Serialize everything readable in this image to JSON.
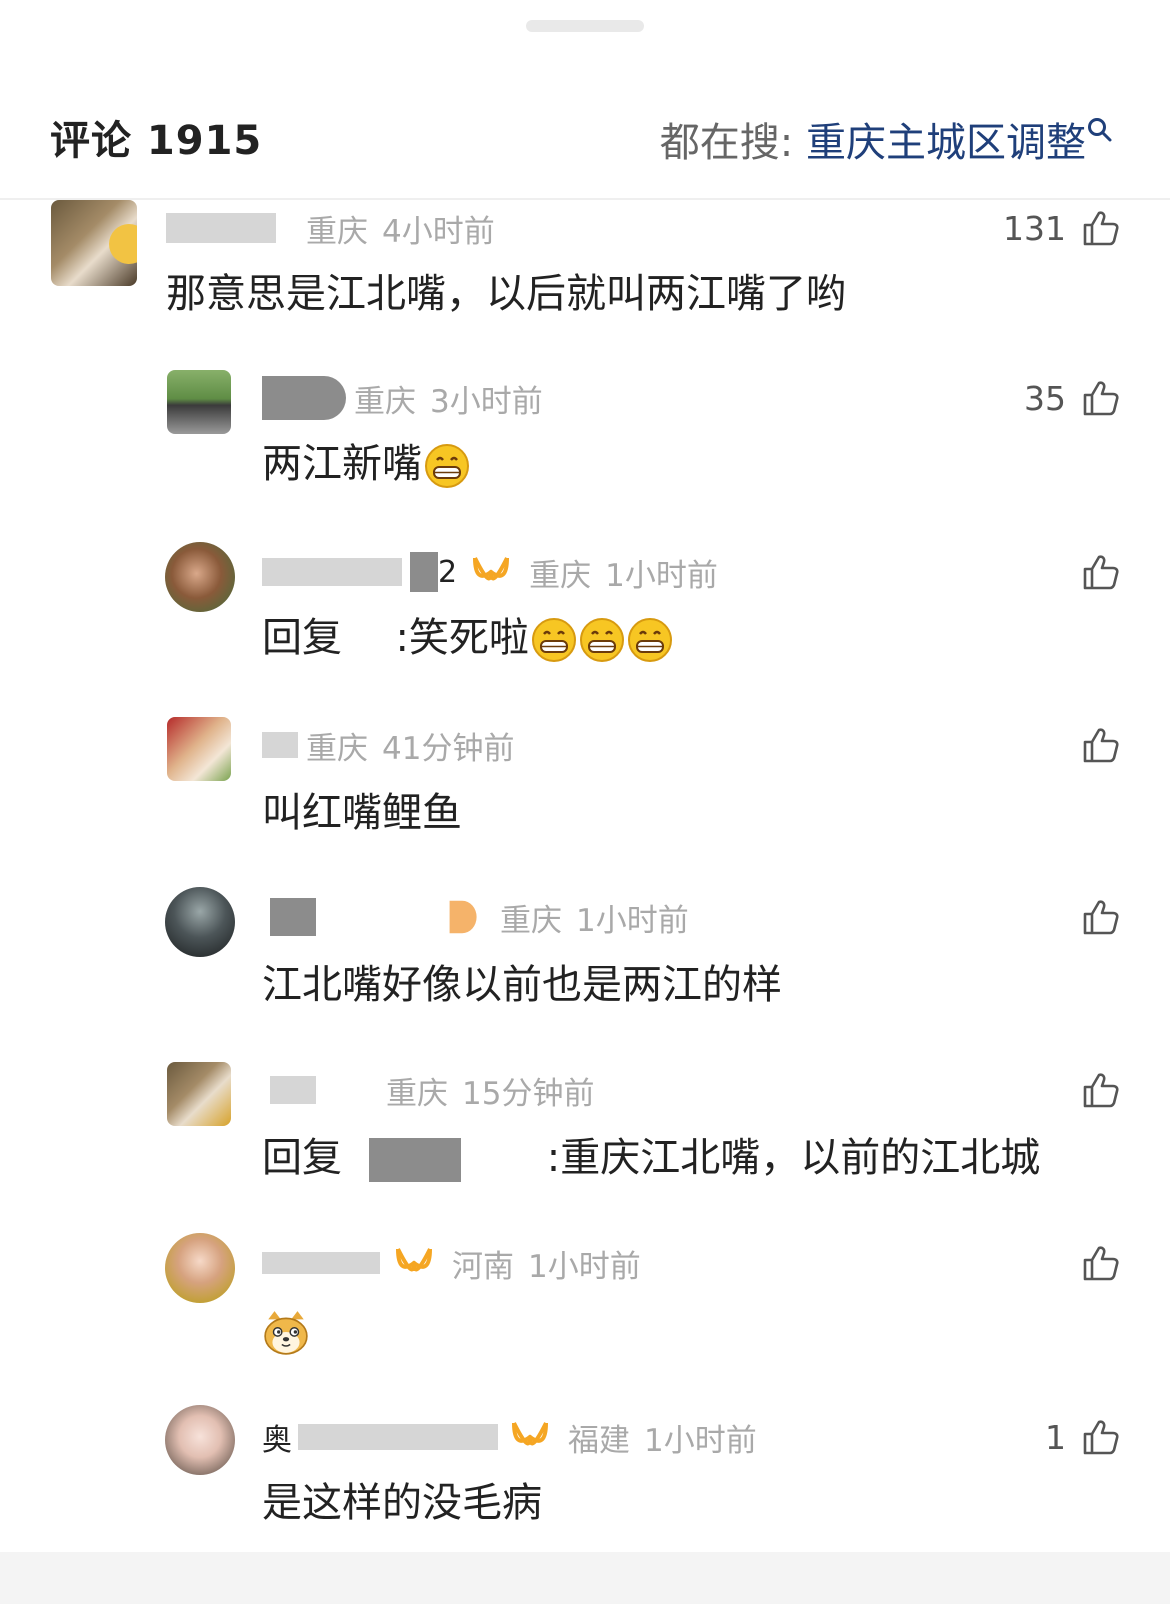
{
  "header": {
    "title": "评论 1915",
    "search_prefix": "都在搜:",
    "search_term": "重庆主城区调整"
  },
  "comments": [
    {
      "name": "",
      "region": "重庆",
      "time": "4小时前",
      "likes": "131",
      "text": "那意思是江北嘴，以后就叫两江嘴了哟"
    },
    {
      "name": "",
      "region": "重庆",
      "time": "3小时前",
      "likes": "35",
      "text": "两江新嘴"
    },
    {
      "name": "2",
      "region": "重庆",
      "time": "1小时前",
      "likes": "",
      "text_prefix": "回复",
      "text": ":笑死啦"
    },
    {
      "name": "",
      "region": "重庆",
      "time": "41分钟前",
      "likes": "",
      "text": "叫红嘴鲤鱼"
    },
    {
      "name": "",
      "region": "重庆",
      "time": "1小时前",
      "likes": "",
      "text": "江北嘴好像以前也是两江的样"
    },
    {
      "name": "",
      "region": "重庆",
      "time": "15分钟前",
      "likes": "",
      "text_prefix": "回复",
      "text": ":重庆江北嘴，以前的江北城"
    },
    {
      "name": "",
      "region": "河南",
      "time": "1小时前",
      "likes": "",
      "text": ""
    },
    {
      "name": "奥",
      "region": "福建",
      "time": "1小时前",
      "likes": "1",
      "text": "是这样的没毛病"
    }
  ],
  "icons": {
    "search": "search-icon",
    "like": "thumbs-up-icon",
    "vip": "vip-badge-icon",
    "emoji_grin": "grinning-emoji",
    "emoji_doge": "doge-emoji"
  },
  "colors": {
    "search_term": "#1f3f7a",
    "vip_badge": "#f5a623",
    "meta_gray": "#a9a9a9"
  }
}
